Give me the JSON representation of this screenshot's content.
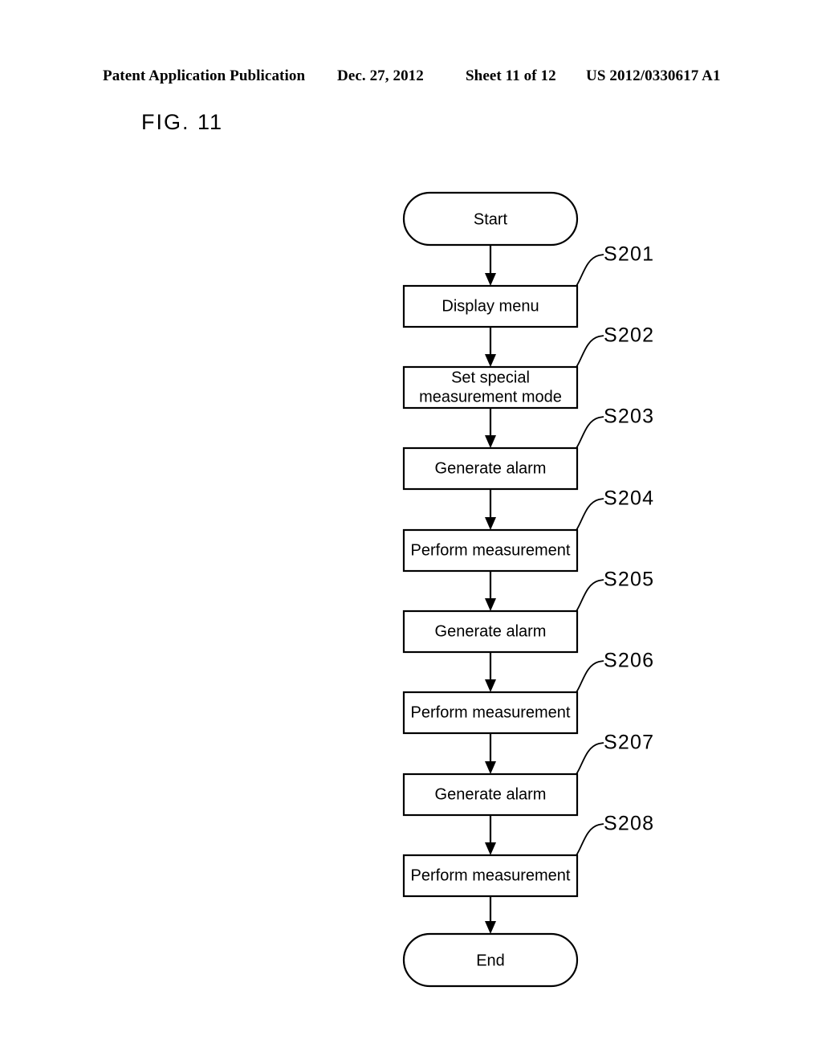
{
  "header": {
    "publication": "Patent Application Publication",
    "date": "Dec. 27, 2012",
    "sheet": "Sheet 11 of 12",
    "patent_number": "US 2012/0330617 A1"
  },
  "figure": {
    "label": "FIG. 11"
  },
  "chart_data": {
    "type": "diagram",
    "diagram_type": "flowchart",
    "title": "FIG. 11",
    "orientation": "vertical",
    "nodes": [
      {
        "id": "start",
        "shape": "terminator",
        "label": "Start",
        "ref": null
      },
      {
        "id": "s201",
        "shape": "process",
        "label": "Display menu",
        "ref": "S201"
      },
      {
        "id": "s202",
        "shape": "process",
        "label": "Set special\nmeasurement mode",
        "ref": "S202"
      },
      {
        "id": "s203",
        "shape": "process",
        "label": "Generate alarm",
        "ref": "S203"
      },
      {
        "id": "s204",
        "shape": "process",
        "label": "Perform measurement",
        "ref": "S204"
      },
      {
        "id": "s205",
        "shape": "process",
        "label": "Generate alarm",
        "ref": "S205"
      },
      {
        "id": "s206",
        "shape": "process",
        "label": "Perform measurement",
        "ref": "S206"
      },
      {
        "id": "s207",
        "shape": "process",
        "label": "Generate alarm",
        "ref": "S207"
      },
      {
        "id": "s208",
        "shape": "process",
        "label": "Perform measurement",
        "ref": "S208"
      },
      {
        "id": "end",
        "shape": "terminator",
        "label": "End",
        "ref": null
      }
    ],
    "edges": [
      {
        "from": "start",
        "to": "s201"
      },
      {
        "from": "s201",
        "to": "s202"
      },
      {
        "from": "s202",
        "to": "s203"
      },
      {
        "from": "s203",
        "to": "s204"
      },
      {
        "from": "s204",
        "to": "s205"
      },
      {
        "from": "s205",
        "to": "s206"
      },
      {
        "from": "s206",
        "to": "s207"
      },
      {
        "from": "s207",
        "to": "s208"
      },
      {
        "from": "s208",
        "to": "end"
      }
    ],
    "colors": {
      "stroke": "#000000",
      "fill": "#ffffff",
      "text": "#000000"
    }
  },
  "nodes": {
    "start": {
      "label": "Start"
    },
    "s201": {
      "label": "Display menu",
      "ref": "S201"
    },
    "s202": {
      "line1": "Set special",
      "line2": "measurement mode",
      "ref": "S202"
    },
    "s203": {
      "label": "Generate alarm",
      "ref": "S203"
    },
    "s204": {
      "label": "Perform measurement",
      "ref": "S204"
    },
    "s205": {
      "label": "Generate alarm",
      "ref": "S205"
    },
    "s206": {
      "label": "Perform measurement",
      "ref": "S206"
    },
    "s207": {
      "label": "Generate alarm",
      "ref": "S207"
    },
    "s208": {
      "label": "Perform measurement",
      "ref": "S208"
    },
    "end": {
      "label": "End"
    }
  }
}
